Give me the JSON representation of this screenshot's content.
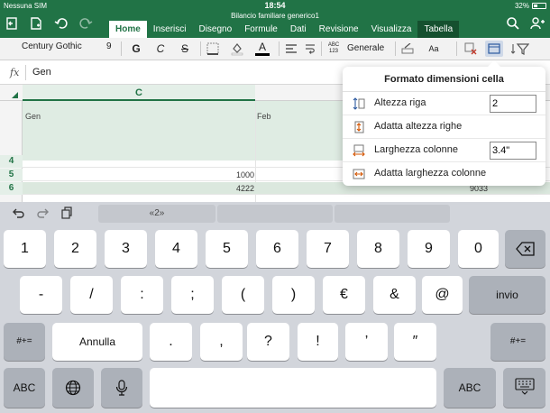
{
  "status": {
    "carrier": "Nessuna SIM",
    "time": "18:54",
    "battery": "32%"
  },
  "document_title": "Bilancio familiare generico1",
  "tabs": [
    "Home",
    "Inserisci",
    "Disegno",
    "Formule",
    "Dati",
    "Revisione",
    "Visualizza",
    "Tabella"
  ],
  "ribbon": {
    "font_name": "Century Gothic",
    "font_size": "9",
    "bold": "G",
    "italic": "C",
    "strike": "S",
    "font_color": "A",
    "number_format_badge": "ABC 123",
    "number_format": "Generale",
    "style_label": "Aa"
  },
  "formula_bar": {
    "fx": "fx",
    "value": "Gen"
  },
  "grid": {
    "column_header": "C",
    "cell_c": "Gen",
    "cell_d": "Feb",
    "rows": [
      {
        "num": "4",
        "v1": "",
        "v2": ""
      },
      {
        "num": "5",
        "v1": "1000",
        "v2": ""
      },
      {
        "num": "6",
        "v1": "4222",
        "v2": "9033"
      }
    ]
  },
  "popover": {
    "title": "Formato dimensioni cella",
    "row_height_label": "Altezza riga",
    "row_height_value": "2",
    "autofit_rows_label": "Adatta altezza righe",
    "col_width_label": "Larghezza colonne",
    "col_width_value": "3.4\"",
    "autofit_cols_label": "Adatta larghezza colonne"
  },
  "keyboard": {
    "suggestion": "«2»",
    "row1": [
      "1",
      "2",
      "3",
      "4",
      "5",
      "6",
      "7",
      "8",
      "9",
      "0"
    ],
    "row2": [
      "-",
      "/",
      ":",
      ";",
      "(",
      ")",
      "€",
      "&",
      "@"
    ],
    "return_label": "invio",
    "row3": [
      ".",
      ",",
      "?",
      "!",
      "’",
      "″"
    ],
    "shift_label": "#+=",
    "undo_label": "Annulla",
    "abc_label": "ABC"
  },
  "colors": {
    "accent": "#217346"
  }
}
